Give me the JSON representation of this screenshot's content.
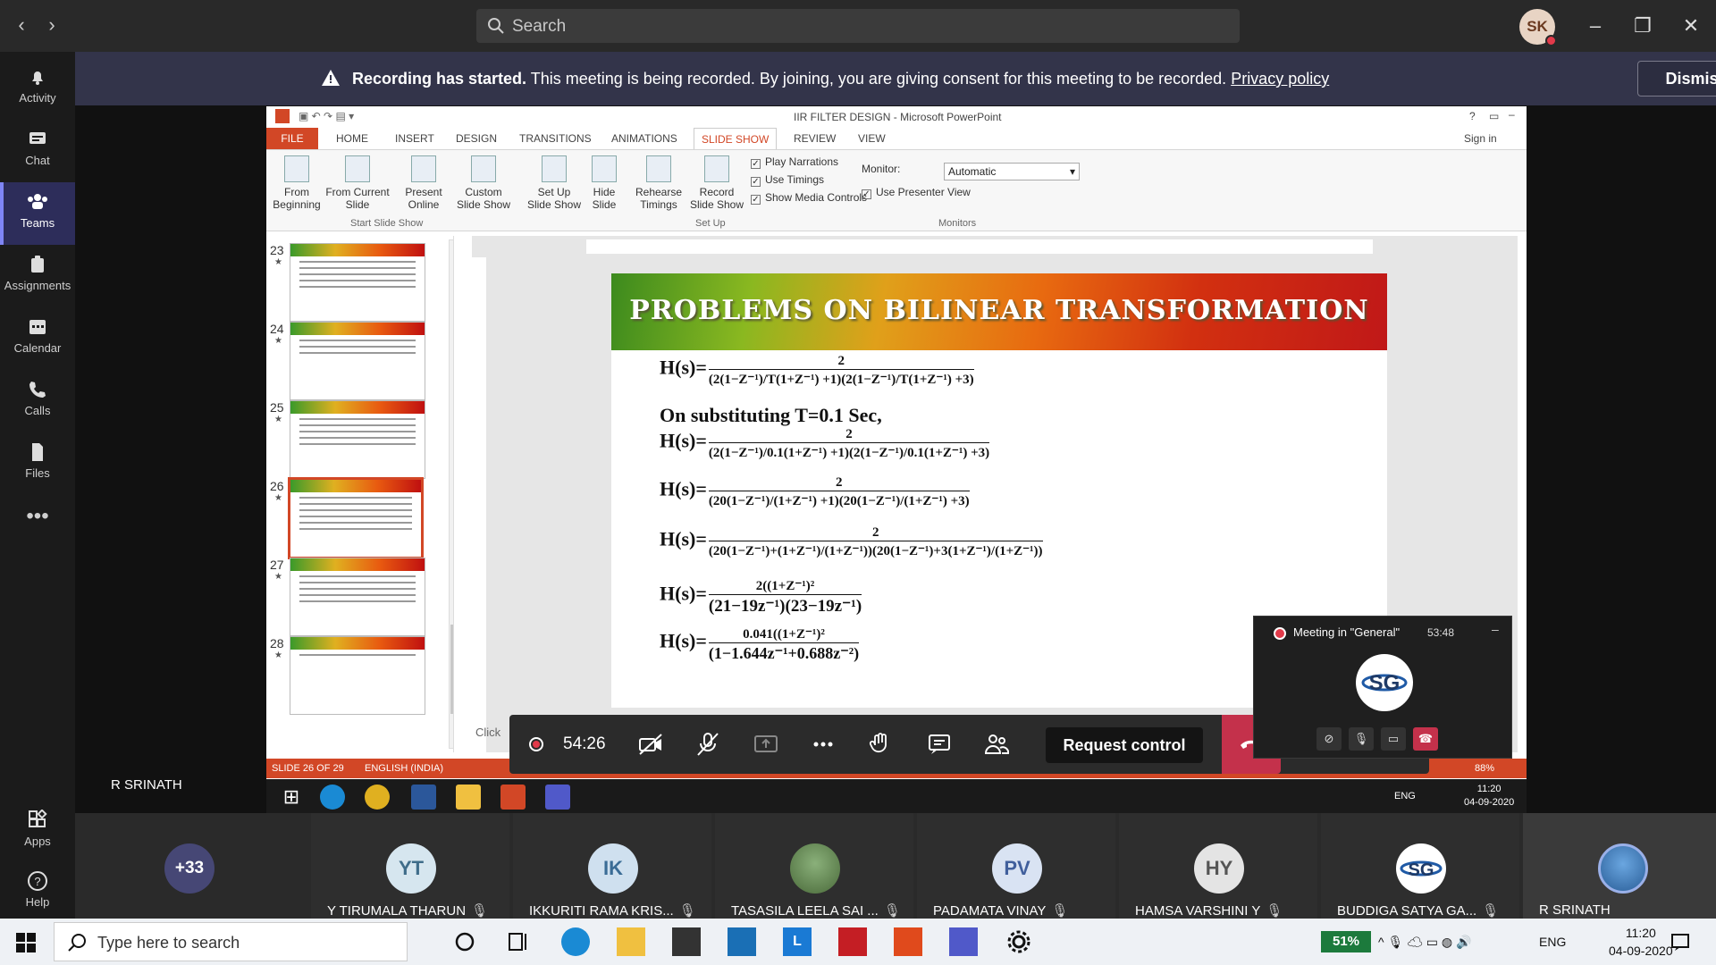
{
  "teams": {
    "search_placeholder": "Search",
    "user_initials": "SK",
    "rail": [
      {
        "label": "Activity",
        "icon": "bell-icon"
      },
      {
        "label": "Chat",
        "icon": "chat-icon"
      },
      {
        "label": "Teams",
        "icon": "teams-icon"
      },
      {
        "label": "Assignments",
        "icon": "assignments-icon"
      },
      {
        "label": "Calendar",
        "icon": "calendar-icon"
      },
      {
        "label": "Calls",
        "icon": "phone-icon"
      },
      {
        "label": "Files",
        "icon": "files-icon"
      },
      {
        "label": "Apps",
        "icon": "apps-icon"
      },
      {
        "label": "Help",
        "icon": "help-icon"
      }
    ]
  },
  "banner": {
    "title": "Recording has started.",
    "message": "This meeting is being recorded. By joining, you are giving consent for this meeting to be recorded.",
    "link": "Privacy policy",
    "dismiss": "Dismiss"
  },
  "presenter": "R SRINATH",
  "ppt": {
    "window_title": "IIR FILTER DESIGN - Microsoft PowerPoint",
    "sign_in": "Sign in",
    "tabs": [
      "FILE",
      "HOME",
      "INSERT",
      "DESIGN",
      "TRANSITIONS",
      "ANIMATIONS",
      "SLIDE SHOW",
      "REVIEW",
      "VIEW"
    ],
    "ribbon": {
      "from_beginning": "From Beginning",
      "from_current": "From Current Slide",
      "present_online": "Present Online",
      "custom_show": "Custom Slide Show",
      "group_start": "Start Slide Show",
      "setup_show": "Set Up Slide Show",
      "hide_slide": "Hide Slide",
      "rehearse": "Rehearse Timings",
      "record": "Record Slide Show",
      "play_narrations": "Play Narrations",
      "use_timings": "Use Timings",
      "show_media": "Show Media Controls",
      "group_setup": "Set Up",
      "monitor_label": "Monitor:",
      "monitor_value": "Automatic",
      "use_presenter": "Use Presenter View",
      "group_monitors": "Monitors"
    },
    "thumbnails": [
      "23",
      "24",
      "25",
      "26",
      "27",
      "28"
    ],
    "slide": {
      "title": "PROBLEMS ON BILINEAR TRANSFORMATION",
      "substituting": "On substituting T=0.1 Sec,",
      "eq_lhs": "H(s)=",
      "eq1_num": "2",
      "eq1_den": "(2(1−Z⁻¹)/T(1+Z⁻¹) +1)(2(1−Z⁻¹)/T(1+Z⁻¹) +3)",
      "eq2_num": "2",
      "eq2_den": "(2(1−Z⁻¹)/0.1(1+Z⁻¹) +1)(2(1−Z⁻¹)/0.1(1+Z⁻¹) +3)",
      "eq3_num": "2",
      "eq3_den": "(20(1−Z⁻¹)/(1+Z⁻¹) +1)(20(1−Z⁻¹)/(1+Z⁻¹) +3)",
      "eq4_num": "2",
      "eq4_den": "(20(1−Z⁻¹)+(1+Z⁻¹)/(1+Z⁻¹))(20(1−Z⁻¹)+3(1+Z⁻¹)/(1+Z⁻¹))",
      "eq5_num": "2((1+Z⁻¹)²",
      "eq5_den": "(21−19z⁻¹)(23−19z⁻¹)",
      "eq6_num": "0.041((1+Z⁻¹)²",
      "eq6_den": "(1−1.644z⁻¹+0.688z⁻²)"
    },
    "status": {
      "slide": "SLIDE 26 OF 29",
      "lang": "ENGLISH (INDIA)",
      "click": "Click",
      "zoom": "88%"
    },
    "inner_time": "11:20",
    "inner_date": "04-09-2020",
    "inner_lang": "ENG"
  },
  "controls": {
    "timer": "54:26",
    "request_control": "Request control"
  },
  "mini": {
    "title": "Meeting in \"General\"",
    "duration": "53:48"
  },
  "participants": {
    "more": "+33",
    "people": [
      {
        "initials": "YT",
        "name": "Y TIRUMALA THARUN",
        "bg": "#d6e6ef",
        "fg": "#3f6d8a"
      },
      {
        "initials": "IK",
        "name": "IKKURITI RAMA KRIS...",
        "bg": "#cfe0ef",
        "fg": "#3a6c96"
      },
      {
        "initials": "",
        "name": "TASASILA LEELA SAI ...",
        "bg": "#7aa06a",
        "fg": "#fff"
      },
      {
        "initials": "PV",
        "name": "PADAMATA VINAY",
        "bg": "#d9e3f3",
        "fg": "#405f9c"
      },
      {
        "initials": "HY",
        "name": "HAMSA VARSHINI Y",
        "bg": "#e4e4e4",
        "fg": "#555"
      },
      {
        "initials": "",
        "name": "BUDDIGA SATYA GA...",
        "bg": "#ffffff",
        "fg": "#234"
      },
      {
        "initials": "",
        "name": "R SRINATH",
        "bg": "#4b8fd0",
        "fg": "#fff"
      }
    ]
  },
  "taskbar": {
    "search_placeholder": "Type here to search",
    "battery": "51%",
    "lang": "ENG",
    "time": "11:20",
    "date": "04-09-2020"
  }
}
